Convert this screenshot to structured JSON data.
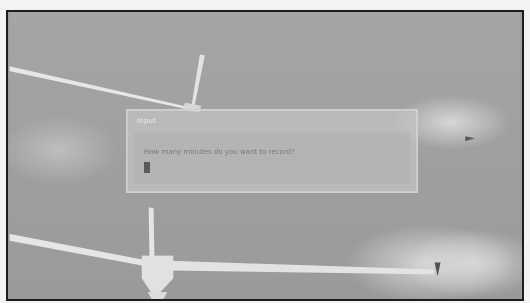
{
  "dialog": {
    "title": "Input",
    "prompt": "How many minutes do you want to record?",
    "input_value": ""
  },
  "colors": {
    "screen_bg": "#9c9c9c",
    "dialog_border": "#cfcfcf",
    "text": "#7a7a7a"
  },
  "icons": {
    "caret": "text-cursor-icon"
  }
}
